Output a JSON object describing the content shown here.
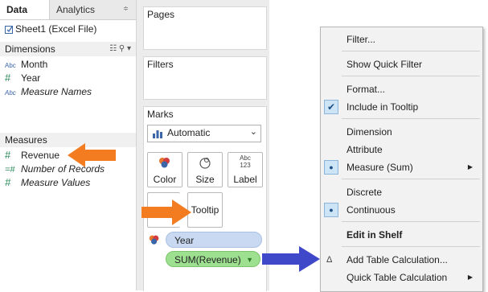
{
  "data_pane": {
    "tabs": [
      "Data",
      "Analytics"
    ],
    "tab_menu_glyph": "≑",
    "datasource": "Sheet1 (Excel File)",
    "dimensions": {
      "header": "Dimensions",
      "fields": [
        {
          "type": "Abc",
          "label": "Month"
        },
        {
          "type": "#",
          "label": "Year"
        },
        {
          "type": "Abc",
          "label": "Measure Names"
        }
      ]
    },
    "measures": {
      "header": "Measures",
      "fields": [
        {
          "type": "#",
          "label": "Revenue"
        },
        {
          "type": "=#",
          "label": "Number of Records"
        },
        {
          "type": "#",
          "label": "Measure Values"
        }
      ]
    }
  },
  "shelves": {
    "pages_title": "Pages",
    "filters_title": "Filters",
    "marks_title": "Marks",
    "mark_type": "Automatic",
    "buttons": {
      "color": "Color",
      "size": "Size",
      "label": "Label",
      "label_icon_text": "Abc",
      "label_icon_num": "123",
      "tooltip": "Tooltip"
    },
    "pills": {
      "year": "Year",
      "sum": "SUM(Revenue)"
    }
  },
  "context_menu": {
    "filter": "Filter...",
    "show_quick_filter": "Show Quick Filter",
    "format": "Format...",
    "include_in_tooltip": "Include in Tooltip",
    "dimension": "Dimension",
    "attribute": "Attribute",
    "measure_sum": "Measure (Sum)",
    "discrete": "Discrete",
    "continuous": "Continuous",
    "edit_in_shelf": "Edit in Shelf",
    "add_table_calculation": "Add Table Calculation...",
    "quick_table_calculation": "Quick Table Calculation",
    "check_glyph": "✔",
    "dot_glyph": "●",
    "submenu_glyph": "▶",
    "delta_glyph": "Δ"
  },
  "colors": {
    "accent_arrow": "#f47c20",
    "blue_arrow": "#3f48c8",
    "pill_dimension": "#c8d9f1",
    "pill_measure": "#9de090"
  }
}
